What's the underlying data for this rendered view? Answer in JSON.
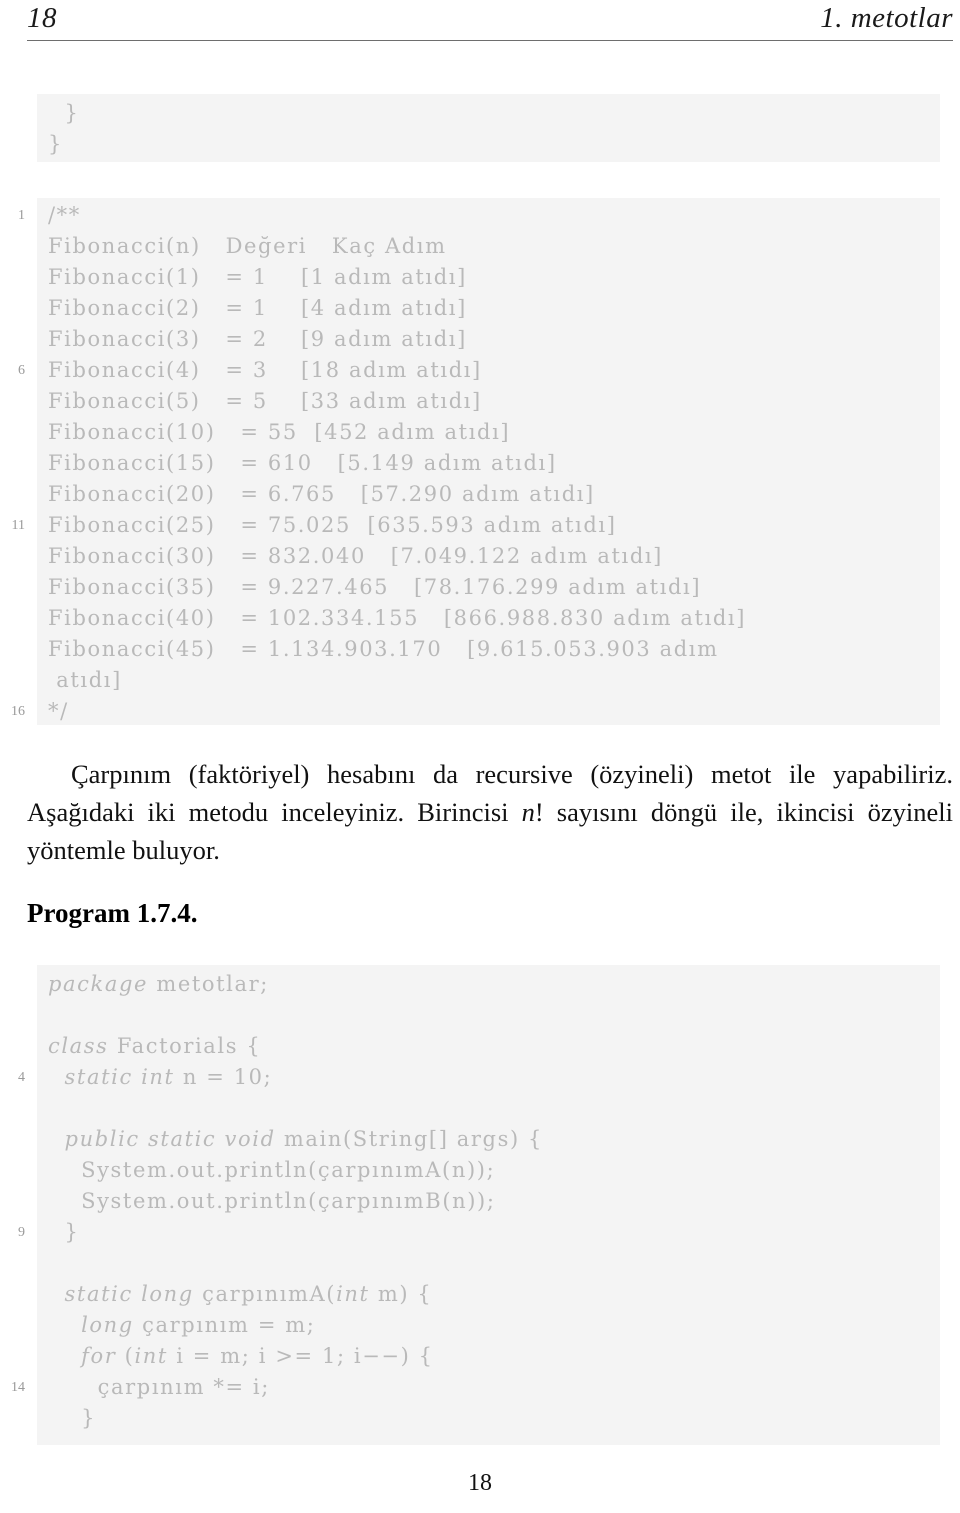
{
  "header": {
    "page_number": "18",
    "chapter_title": "1. metotlar"
  },
  "footer": {
    "page_number": "18"
  },
  "listing_top": {
    "lines": [
      {
        "num": "",
        "text": "  }"
      },
      {
        "num": "",
        "text": "}"
      }
    ]
  },
  "listing_fibonacci": {
    "lines": [
      {
        "num": "1",
        "text": "/**"
      },
      {
        "num": "",
        "text": "Fibonacci(n)   Değeri   Kaç Adım"
      },
      {
        "num": "",
        "text": "Fibonacci(1)   = 1    [1 adım atıdı]"
      },
      {
        "num": "",
        "text": "Fibonacci(2)   = 1    [4 adım atıdı]"
      },
      {
        "num": "",
        "text": "Fibonacci(3)   = 2    [9 adım atıdı]"
      },
      {
        "num": "6",
        "text": "Fibonacci(4)   = 3    [18 adım atıdı]"
      },
      {
        "num": "",
        "text": "Fibonacci(5)   = 5    [33 adım atıdı]"
      },
      {
        "num": "",
        "text": "Fibonacci(10)   = 55  [452 adım atıdı]"
      },
      {
        "num": "",
        "text": "Fibonacci(15)   = 610   [5.149 adım atıdı]"
      },
      {
        "num": "",
        "text": "Fibonacci(20)   = 6.765   [57.290 adım atıdı]"
      },
      {
        "num": "11",
        "text": "Fibonacci(25)   = 75.025  [635.593 adım atıdı]"
      },
      {
        "num": "",
        "text": "Fibonacci(30)   = 832.040   [7.049.122 adım atıdı]"
      },
      {
        "num": "",
        "text": "Fibonacci(35)   = 9.227.465   [78.176.299 adım atıdı]"
      },
      {
        "num": "",
        "text": "Fibonacci(40)   = 102.334.155   [866.988.830 adım atıdı]"
      },
      {
        "num": "",
        "text": "Fibonacci(45)   = 1.134.903.170   [9.615.053.903 adım"
      },
      {
        "num": "",
        "text": " atıdı]"
      },
      {
        "num": "16",
        "text": "*/"
      }
    ]
  },
  "paragraph": {
    "text_before_math": "Çarpınım (faktöriyel) hesabını da recursive (özyineli) metot ile yapabiliriz. Aşağıdaki iki metodu inceleyiniz. Birincisi ",
    "math": "n",
    "text_after_math": "! sayısını döngü ile, ikincisi özyineli yöntemle buluyor."
  },
  "program_heading": "Program 1.7.4.",
  "listing_factorials": {
    "lines": [
      {
        "num": "",
        "kw": "package",
        "rest": " metotlar;"
      },
      {
        "num": "",
        "kw": "",
        "rest": ""
      },
      {
        "num": "",
        "kw": "class",
        "rest": " Factorials {"
      },
      {
        "num": "4",
        "kw": "  static int",
        "rest": " n = 10;"
      },
      {
        "num": "",
        "kw": "",
        "rest": ""
      },
      {
        "num": "",
        "kw": "  public static void",
        "rest": " main(String[] args) {"
      },
      {
        "num": "",
        "kw": "",
        "rest": "    System.out.println(çarpınımA(n));"
      },
      {
        "num": "",
        "kw": "",
        "rest": "    System.out.println(çarpınımB(n));"
      },
      {
        "num": "9",
        "kw": "",
        "rest": "  }"
      },
      {
        "num": "",
        "kw": "",
        "rest": ""
      },
      {
        "num": "",
        "kw": "  static long",
        "rest": " çarpınımA(",
        "kw2": "int",
        "rest2": " m) {"
      },
      {
        "num": "",
        "kw": "    long",
        "rest": " çarpınım = m;"
      },
      {
        "num": "",
        "kw": "    for",
        "rest": " (",
        "kw2": "int",
        "rest2": " i = m; i >= 1; i−−) {"
      },
      {
        "num": "14",
        "kw": "",
        "rest": "      çarpınım *= i;"
      },
      {
        "num": "",
        "kw": "",
        "rest": "    }"
      }
    ]
  }
}
